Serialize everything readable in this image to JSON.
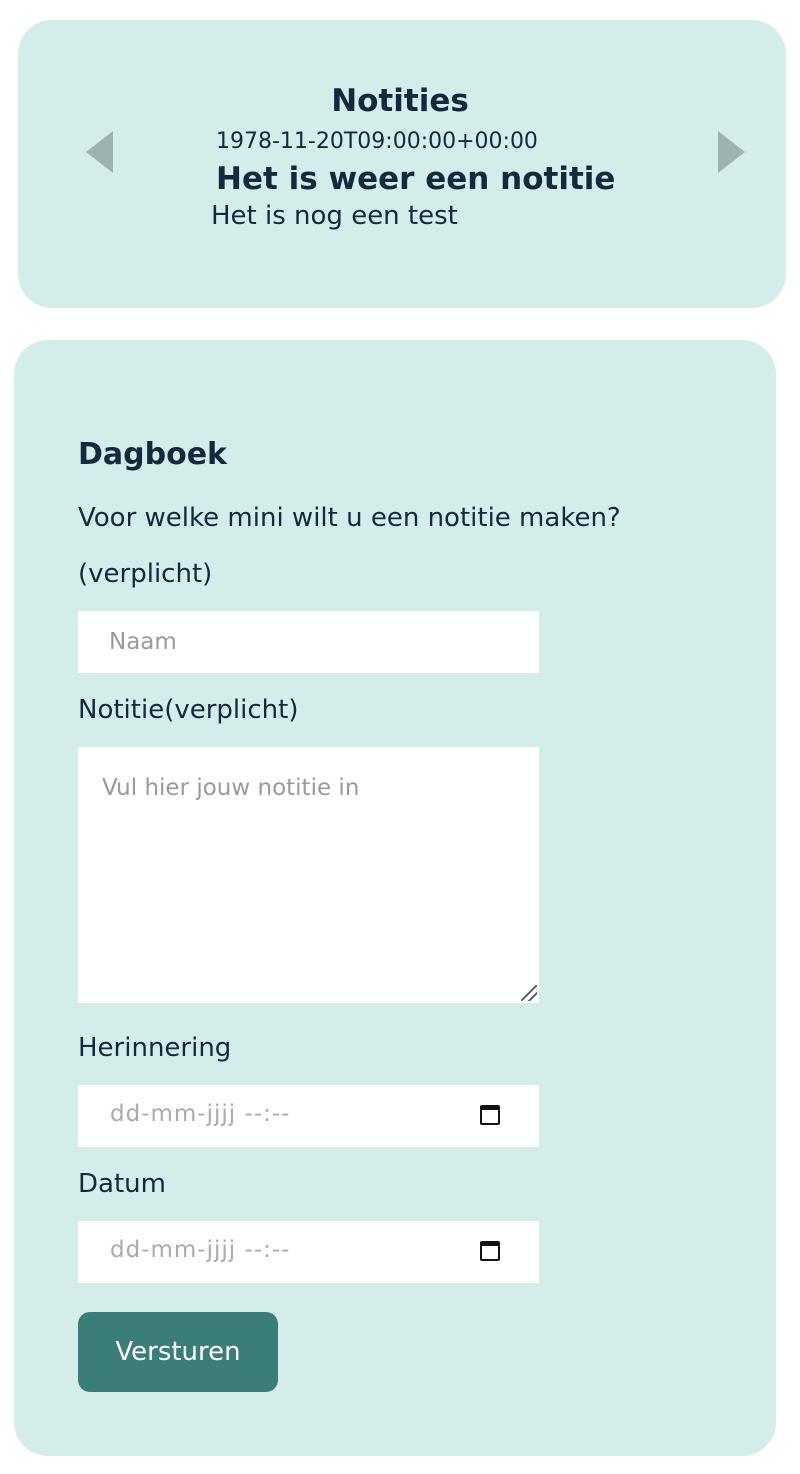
{
  "notes": {
    "title": "Notities",
    "date": "1978-11-20T09:00:00+00:00",
    "heading": "Het is weer een notitie",
    "body": "Het is nog een test",
    "prev_icon": "triangle-left",
    "next_icon": "triangle-right"
  },
  "form": {
    "title": "Dagboek",
    "question": "Voor welke mini wilt u een notitie maken?",
    "required_label": "(verplicht)",
    "name_placeholder": "Naam",
    "note_label": "Notitie(verplicht)",
    "note_placeholder": "Vul hier jouw notitie in",
    "reminder_label": "Herinnering",
    "reminder_placeholder": "dd-mm-jjjj --:--",
    "date_label": "Datum",
    "date_placeholder": "dd-mm-jjjj --:--",
    "submit_label": "Versturen"
  },
  "colors": {
    "card_background": "#d4ecea",
    "text": "#14293f",
    "button": "#3b7d79",
    "arrow": "#9cb3b1"
  }
}
